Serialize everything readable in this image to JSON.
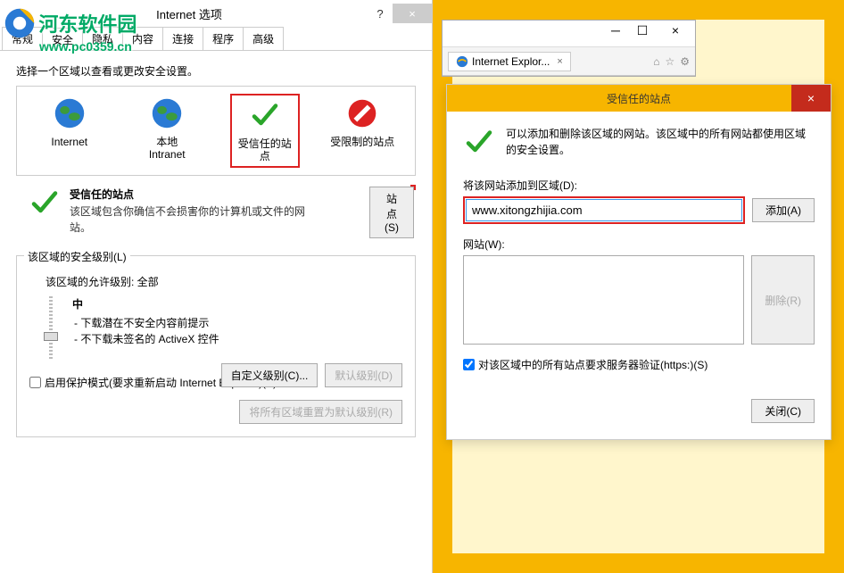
{
  "watermark": {
    "text": "河东软件园",
    "url": "www.pc0359.cn"
  },
  "leftDialog": {
    "title": "Internet 选项",
    "help": "?",
    "close": "×",
    "tabs": [
      "常规",
      "安全",
      "隐私",
      "内容",
      "连接",
      "程序",
      "高级"
    ],
    "activeTab": 1,
    "selectZoneLabel": "选择一个区域以查看或更改安全设置。",
    "zones": [
      {
        "name": "Internet",
        "icon": "globe"
      },
      {
        "name": "本地\nIntranet",
        "icon": "globe"
      },
      {
        "name": "受信任的站点",
        "icon": "check",
        "selected": true
      },
      {
        "name": "受限制的站点",
        "icon": "forbid"
      }
    ],
    "descTitle": "受信任的站点",
    "descText": "该区域包含你确信不会损害你的计算机或文件的网站。",
    "sitesBtn": "站点(S)",
    "levelLegend": "该区域的安全级别(L)",
    "allowLabel": "该区域的允许级别: 全部",
    "levelName": "中",
    "levelLine1": "- 下载潜在不安全内容前提示",
    "levelLine2": "- 不下载未签名的 ActiveX 控件",
    "protectLabel": "启用保护模式(要求重新启动 Internet Explorer)(P)",
    "customBtn": "自定义级别(C)...",
    "defaultBtn": "默认级别(D)",
    "resetBtn": "将所有区域重置为默认级别(R)"
  },
  "ieWindow": {
    "tabTitle": "Internet Explor...",
    "tabClose": "×"
  },
  "trustedDialog": {
    "title": "受信任的站点",
    "close": "×",
    "message": "可以添加和删除该区域的网站。该区域中的所有网站都使用区域的安全设置。",
    "addLabel": "将该网站添加到区域(D):",
    "addValue": "www.xitongzhijia.com",
    "addBtn": "添加(A)",
    "sitesLabel": "网站(W):",
    "removeBtn": "删除(R)",
    "httpsLabel": "对该区域中的所有站点要求服务器验证(https:)(S)",
    "httpsChecked": true,
    "closeBtn": "关闭(C)"
  }
}
